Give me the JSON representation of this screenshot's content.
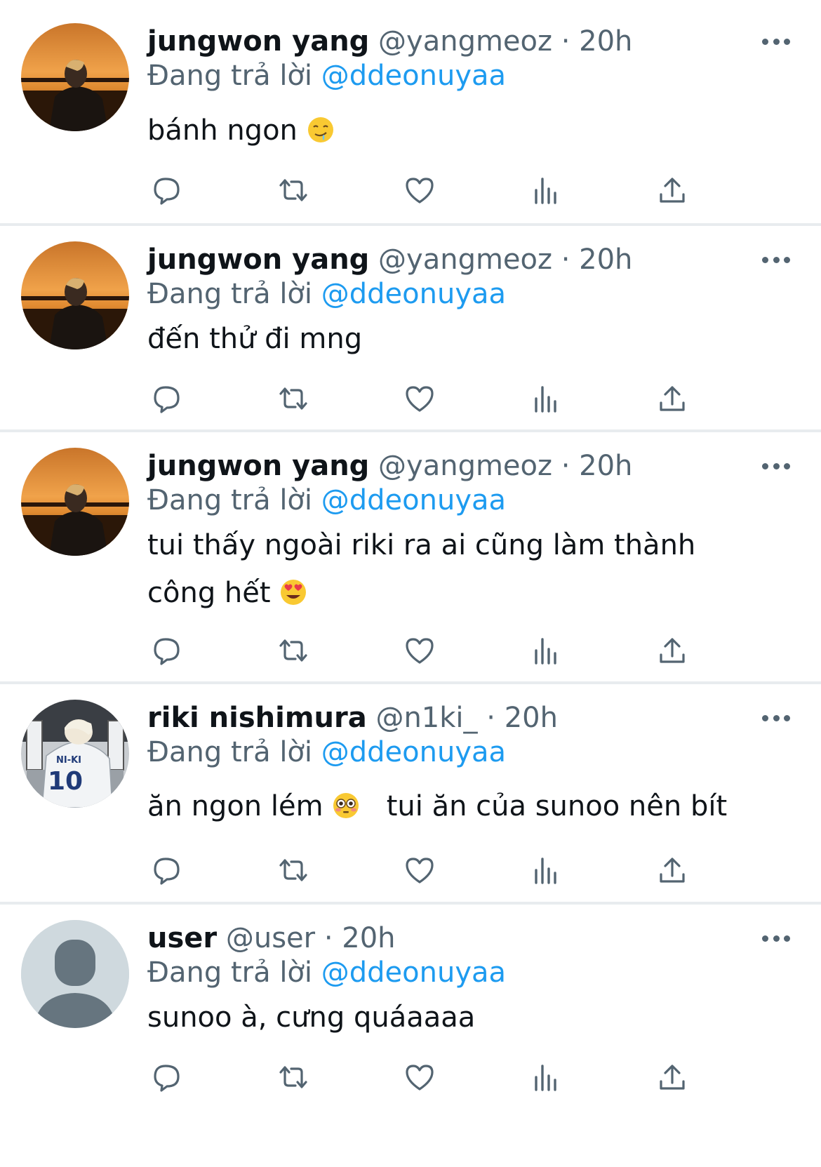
{
  "colors": {
    "accent": "#1d9bf0",
    "secondary": "#536471",
    "text": "#0f1419",
    "divider": "#e8ecef"
  },
  "common": {
    "replying_prefix": "Đang trả lời",
    "replying_to": "@ddeonuyaa",
    "dot": "·"
  },
  "tweets": [
    {
      "name": "jungwon yang",
      "handle": "@yangmeoz",
      "time": "20h",
      "text": "bánh ngon",
      "emoji": "drooling-face-emoji",
      "avatar": "sunset-portrait"
    },
    {
      "name": "jungwon yang",
      "handle": "@yangmeoz",
      "time": "20h",
      "text": "đến thử đi mng",
      "avatar": "sunset-portrait"
    },
    {
      "name": "jungwon yang",
      "handle": "@yangmeoz",
      "time": "20h",
      "text": "tui thấy ngoài riki ra ai cũng làm thành công hết",
      "emoji": "heart-eyes-emoji",
      "avatar": "sunset-portrait"
    },
    {
      "name": "riki nishimura",
      "handle": "@n1ki_",
      "time": "20h",
      "text_before": "ăn ngon lém",
      "emoji": "flushed-face-emoji",
      "text_after": "tui ăn của sunoo nên bít",
      "avatar": "jersey-photo",
      "jersey_text": "NI-KI",
      "jersey_number": "10"
    },
    {
      "name": "user",
      "handle": "@user",
      "time": "20h",
      "text": "sunoo à, cưng quáaaaa",
      "avatar": "default-avatar"
    }
  ],
  "action_icons": [
    "reply-icon",
    "retweet-icon",
    "like-icon",
    "views-icon",
    "share-icon"
  ]
}
